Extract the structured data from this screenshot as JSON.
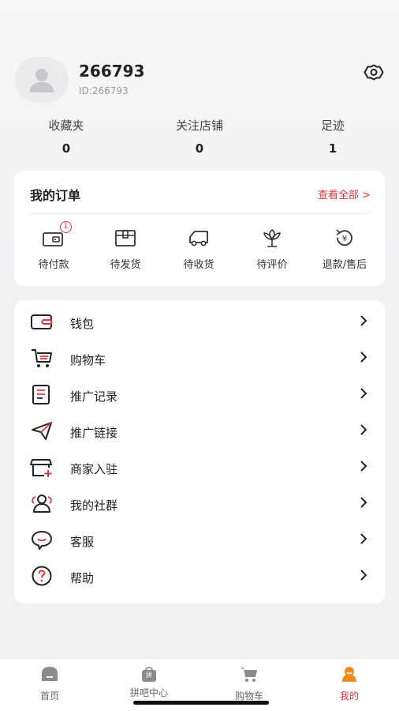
{
  "profile": {
    "username": "266793",
    "user_id": "ID:266793"
  },
  "stats": [
    {
      "label": "收藏夹",
      "value": "0"
    },
    {
      "label": "关注店铺",
      "value": "0"
    },
    {
      "label": "足迹",
      "value": "1"
    }
  ],
  "orders": {
    "title": "我的订单",
    "view_all": "查看全部 >",
    "items": [
      {
        "label": "待付款",
        "icon": "wallet-pay-icon",
        "badge": "1"
      },
      {
        "label": "待发货",
        "icon": "box-icon"
      },
      {
        "label": "待收货",
        "icon": "truck-icon"
      },
      {
        "label": "待评价",
        "icon": "flower-icon"
      },
      {
        "label": "退款/售后",
        "icon": "refund-icon"
      }
    ]
  },
  "menu": [
    {
      "label": "钱包",
      "icon": "wallet-icon"
    },
    {
      "label": "购物车",
      "icon": "cart-icon"
    },
    {
      "label": "推广记录",
      "icon": "document-icon"
    },
    {
      "label": "推广链接",
      "icon": "paper-plane-icon"
    },
    {
      "label": "商家入驻",
      "icon": "store-icon"
    },
    {
      "label": "我的社群",
      "icon": "group-icon"
    },
    {
      "label": "客服",
      "icon": "chat-icon"
    },
    {
      "label": "帮助",
      "icon": "help-icon"
    }
  ],
  "tabbar": [
    {
      "label": "首页",
      "icon": "home-icon"
    },
    {
      "label": "拼吧中心",
      "icon": "bag-icon",
      "icon_text": "拼"
    },
    {
      "label": "购物车",
      "icon": "cart-icon"
    },
    {
      "label": "我的",
      "icon": "profile-icon",
      "active": true
    }
  ],
  "colors": {
    "accent": "#e0343a",
    "background": "#f2f2f5",
    "card": "#ffffff"
  }
}
